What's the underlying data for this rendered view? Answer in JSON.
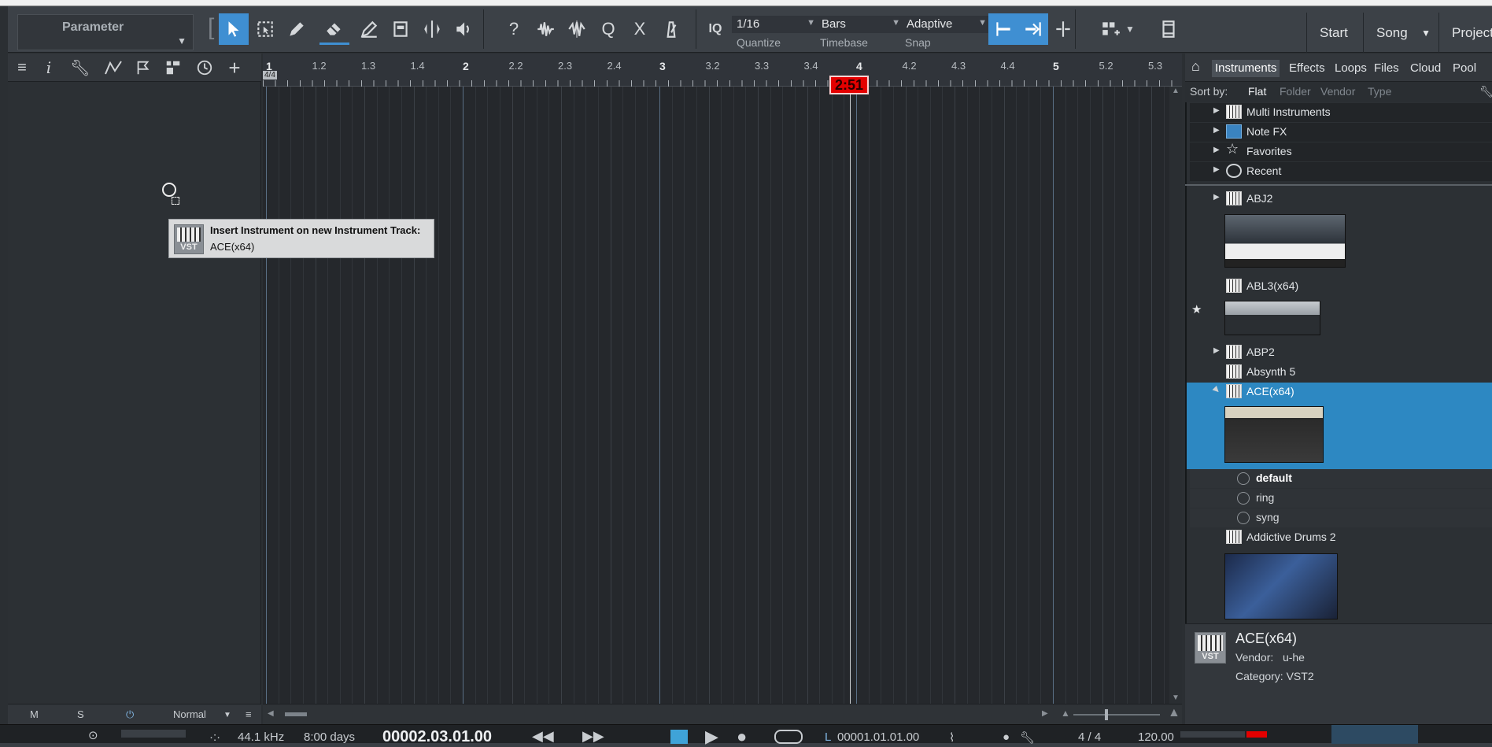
{
  "toolbar": {
    "parameter_label": "Parameter",
    "quantize_value": "1/16",
    "timebase_value": "Bars",
    "snap_value": "Adaptive",
    "quantize_label": "Quantize",
    "timebase_label": "Timebase",
    "snap_label": "Snap",
    "iq_label": "IQ",
    "start_label": "Start",
    "song_label": "Song",
    "project_label": "Project"
  },
  "ruler": {
    "time_signature": "4/4",
    "labels": [
      "1",
      "1.2",
      "1.3",
      "1.4",
      "2",
      "2.2",
      "2.3",
      "2.4",
      "3",
      "3.2",
      "3.3",
      "3.4",
      "4",
      "4.2",
      "4.3",
      "4.4",
      "5",
      "5.2",
      "5.3"
    ]
  },
  "playhead": {
    "time": "2:51"
  },
  "tooltip": {
    "title": "Insert Instrument on new Instrument Track:",
    "name": "ACE(x64)",
    "badge": "VST"
  },
  "left_bottom": {
    "m": "M",
    "s": "S",
    "mode": "Normal"
  },
  "transport": {
    "sample_rate": "44.1 kHz",
    "record_time": "8:00 days",
    "position": "00002.03.01.00",
    "loop_start_prefix": "L",
    "loop_start": "00001.01.01.00",
    "signature": "4 / 4",
    "tempo": "120.00"
  },
  "browser": {
    "tabs": [
      "Instruments",
      "Effects",
      "Loops",
      "Files",
      "Cloud",
      "Pool"
    ],
    "sort_label": "Sort by:",
    "sort_options": [
      "Flat",
      "Folder",
      "Vendor",
      "Type"
    ],
    "folders": [
      "Multi Instruments",
      "Note FX",
      "Favorites",
      "Recent"
    ],
    "instruments": [
      "ABJ2",
      "ABL3(x64)",
      "ABP2",
      "Absynth 5",
      "ACE(x64)",
      "Addictive Drums 2"
    ],
    "presets": [
      "default",
      "ring",
      "syng"
    ],
    "info": {
      "name": "ACE(x64)",
      "vendor_label": "Vendor:",
      "vendor": "u-he",
      "category": "Category: VST2",
      "badge": "VST"
    }
  },
  "colors": {
    "accent": "#3f8fd2",
    "selection": "#2d88c2",
    "playhead": "#e40000"
  }
}
